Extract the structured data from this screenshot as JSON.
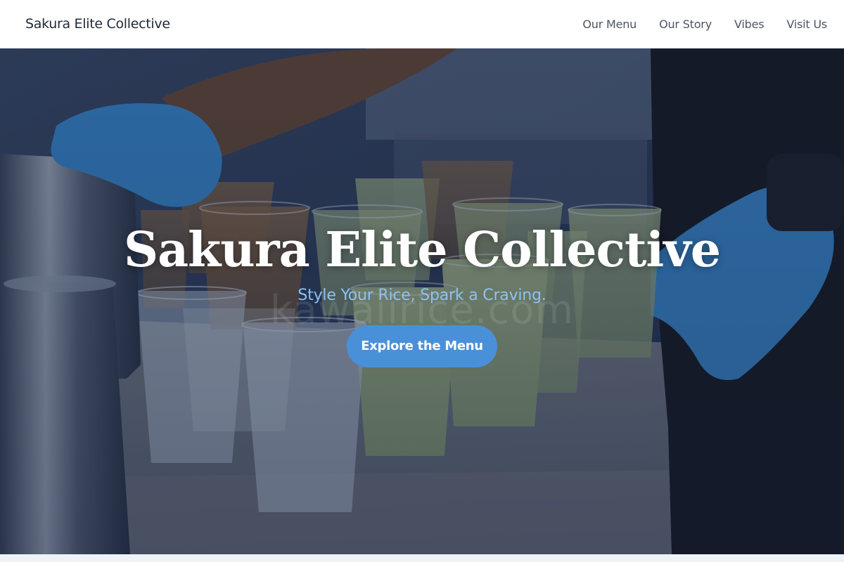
{
  "nav": {
    "brand": "Sakura Elite Collective",
    "links": [
      {
        "label": "Our Menu"
      },
      {
        "label": "Our Story"
      },
      {
        "label": "Vibes"
      },
      {
        "label": "Visit Us"
      }
    ]
  },
  "hero": {
    "title": "Sakura Elite Collective",
    "tagline": "Style Your Rice, Spark a Craving.",
    "cta_label": "Explore the Menu",
    "watermark": "kawaiirice.com",
    "image_subject": "barista-pouring-iced-matcha-drinks"
  },
  "colors": {
    "accent": "#4a90d9",
    "tagline": "#8cc2f0",
    "overlay": "#121e3a",
    "nav_text": "#4b5563",
    "brand_text": "#1f2937"
  }
}
